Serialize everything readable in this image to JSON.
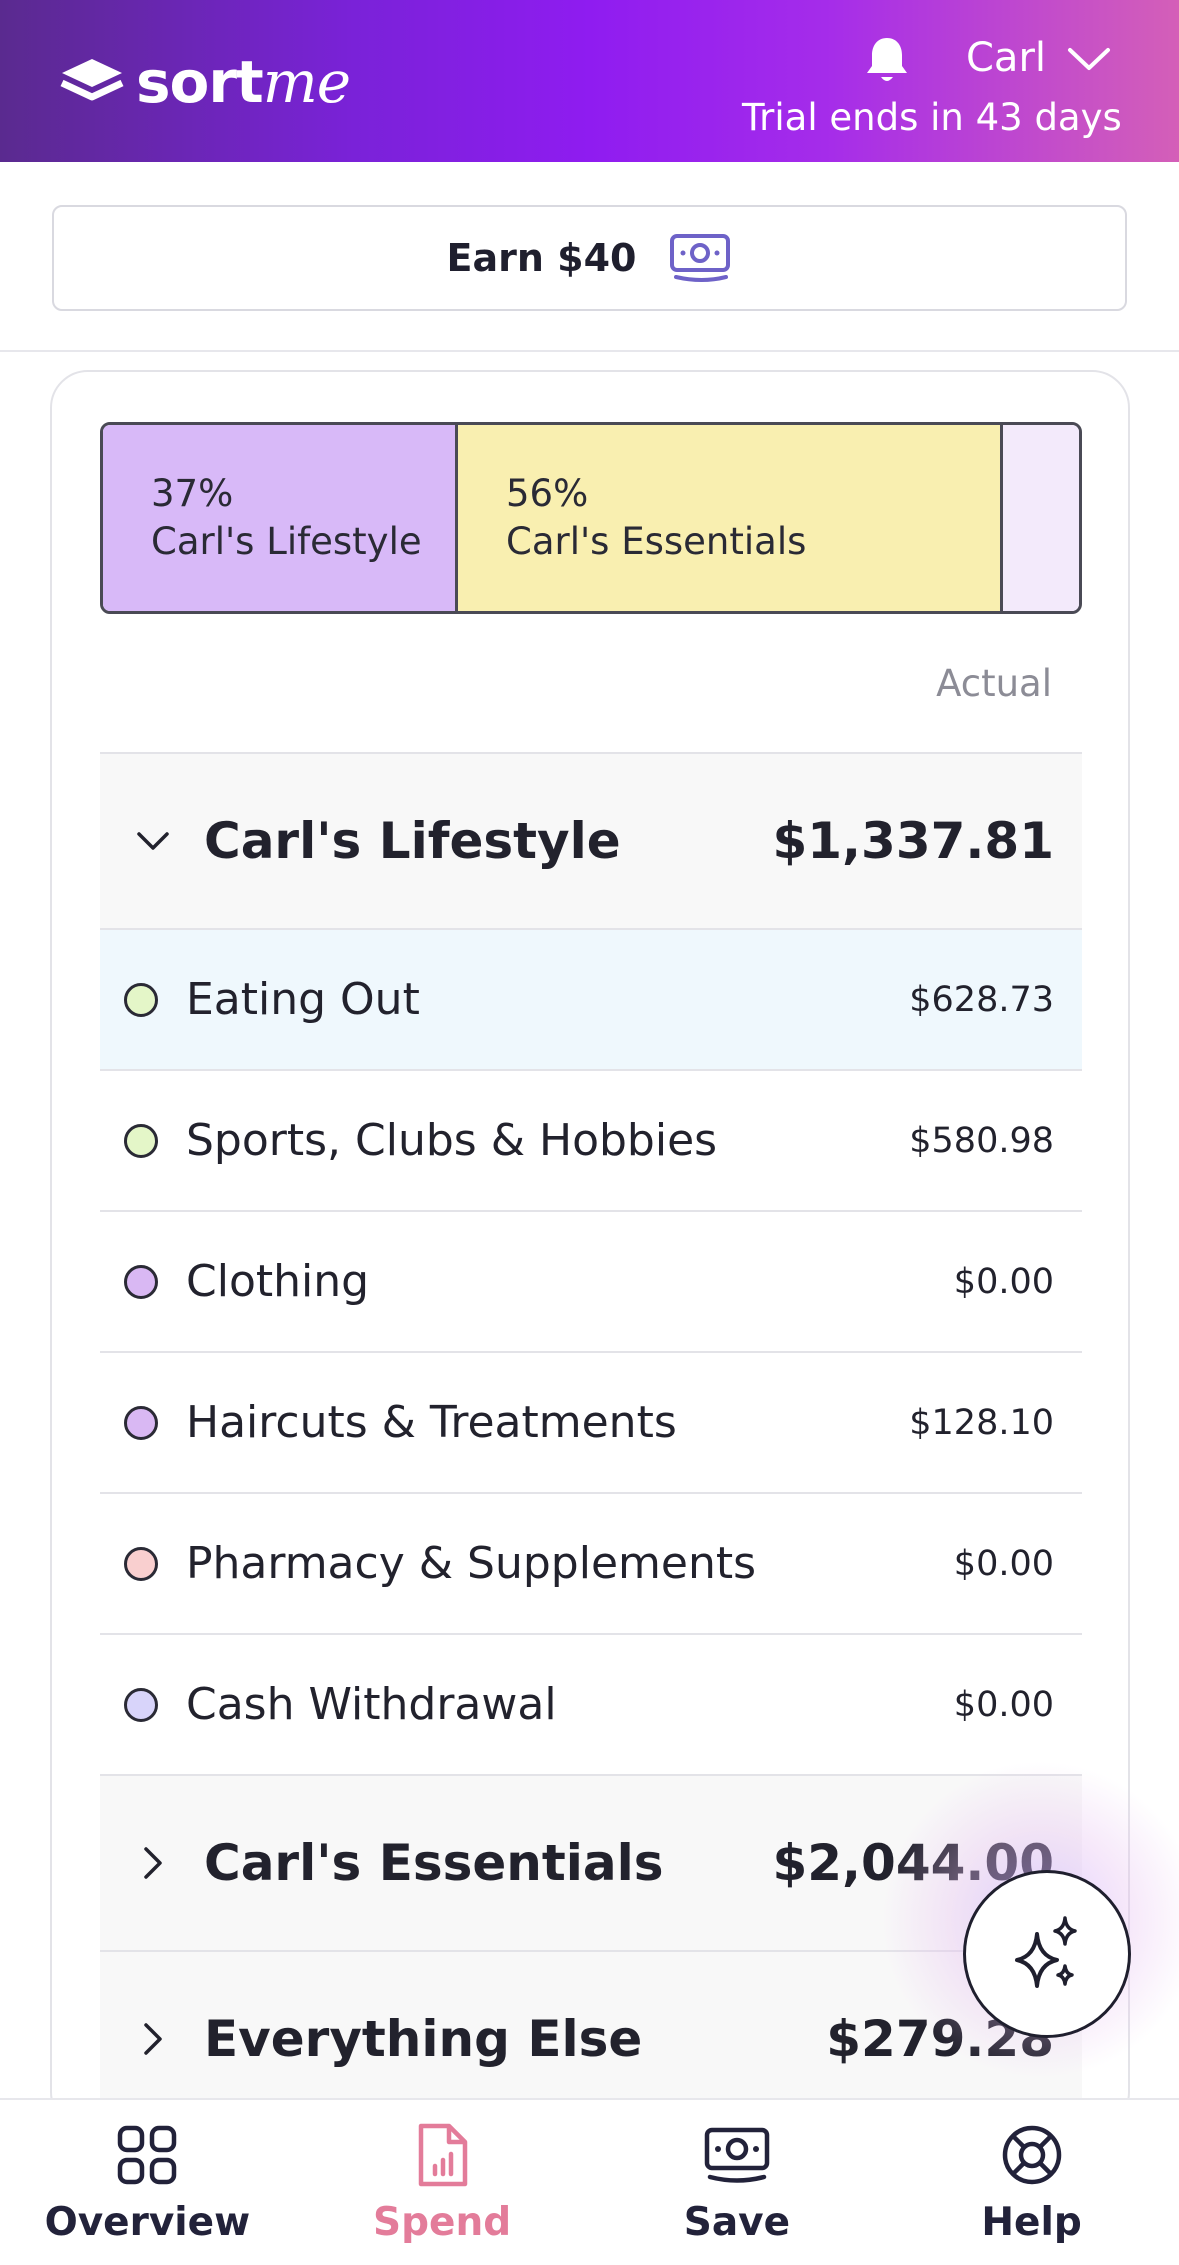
{
  "header": {
    "logo_text": "sort",
    "logo_text_italic": "me",
    "user_name": "Carl",
    "trial_text": "Trial ends in 43 days",
    "icons": [
      "bell-icon",
      "chevron-down-icon"
    ]
  },
  "earn": {
    "label": "Earn $40",
    "icon": "money-icon"
  },
  "split_bar": [
    {
      "percent": "37%",
      "label": "Carl's Lifestyle",
      "color": "#d8b9f8",
      "share": 0.37
    },
    {
      "percent": "56%",
      "label": "Carl's Essentials",
      "color": "#f9efb0",
      "share": 0.56
    },
    {
      "percent": "",
      "label": "",
      "color": "#f3eafb",
      "share": 0.07
    }
  ],
  "column_header": "Actual",
  "groups": [
    {
      "name": "Carl's Lifestyle",
      "amount": "$1,337.81",
      "expanded": true,
      "items": [
        {
          "name": "Eating Out",
          "amount": "$628.73",
          "dot_color": "#e4f6c8",
          "active": true
        },
        {
          "name": "Sports, Clubs & Hobbies",
          "amount": "$580.98",
          "dot_color": "#e4f6c8"
        },
        {
          "name": "Clothing",
          "amount": "$0.00",
          "dot_color": "#d9b8f3"
        },
        {
          "name": "Haircuts & Treatments",
          "amount": "$128.10",
          "dot_color": "#d9b8f3"
        },
        {
          "name": "Pharmacy & Supplements",
          "amount": "$0.00",
          "dot_color": "#f9cfcf"
        },
        {
          "name": "Cash Withdrawal",
          "amount": "$0.00",
          "dot_color": "#d8d4fa"
        }
      ]
    },
    {
      "name": "Carl's Essentials",
      "amount": "$2,044.00",
      "expanded": false
    },
    {
      "name": "Everything Else",
      "amount": "$279.28",
      "expanded": false
    }
  ],
  "fab": {
    "icon": "sparkles-icon"
  },
  "bottom_nav": [
    {
      "label": "Overview",
      "icon": "grid-icon",
      "active": false
    },
    {
      "label": "Spend",
      "icon": "receipt-chart-icon",
      "active": true
    },
    {
      "label": "Save",
      "icon": "money-icon",
      "active": false
    },
    {
      "label": "Help",
      "icon": "lifebuoy-icon",
      "active": false
    }
  ],
  "colors": {
    "accent": "#8f1cf0",
    "active_nav": "#e37c9a"
  }
}
